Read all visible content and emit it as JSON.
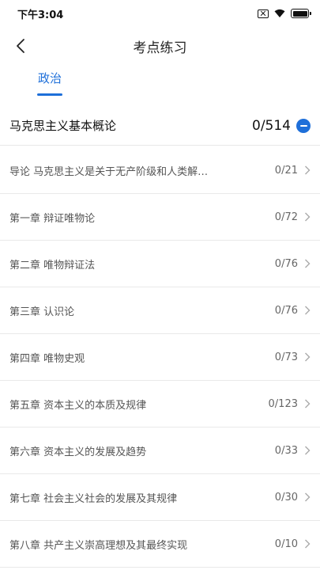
{
  "status_bar": {
    "time": "下午3:04",
    "icons": [
      "no-sim-icon",
      "wifi-icon",
      "battery-icon"
    ]
  },
  "nav": {
    "back_icon": "chevron-left-icon",
    "title": "考点练习"
  },
  "tabs": [
    {
      "label": "政治",
      "active": true
    }
  ],
  "subject": {
    "title": "马克思主义基本概论",
    "progress": "0/514",
    "toggle_icon": "collapse-minus-icon"
  },
  "chapters": [
    {
      "title": "导论 马克思主义是关于无产阶级和人类解…",
      "progress": "0/21"
    },
    {
      "title": "第一章 辩证唯物论",
      "progress": "0/72"
    },
    {
      "title": "第二章 唯物辩证法",
      "progress": "0/76"
    },
    {
      "title": "第三章 认识论",
      "progress": "0/76"
    },
    {
      "title": "第四章 唯物史观",
      "progress": "0/73"
    },
    {
      "title": "第五章 资本主义的本质及规律",
      "progress": "0/123"
    },
    {
      "title": "第六章 资本主义的发展及趋势",
      "progress": "0/33"
    },
    {
      "title": "第七章 社会主义社会的发展及其规律",
      "progress": "0/30"
    },
    {
      "title": "第八章 共产主义崇高理想及其最终实现",
      "progress": "0/10"
    }
  ],
  "colors": {
    "accent": "#1e6fd9",
    "divider": "#e9e9e9"
  }
}
